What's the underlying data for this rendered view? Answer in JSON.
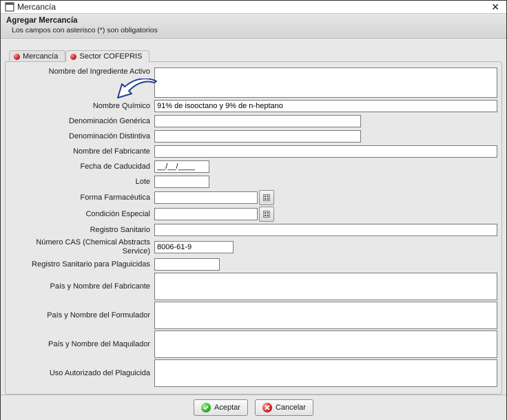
{
  "window": {
    "title": "Mercancía"
  },
  "header": {
    "title": "Agregar Mercancía",
    "subtitle": "Los campos con asterisco (*) son obligatorios"
  },
  "tabs": {
    "mercancia": "Mercancía",
    "cofepris": "Sector COFEPRIS"
  },
  "labels": {
    "nombre_ingrediente": "Nombre del Ingrediente Activo",
    "nombre_quimico": "Nombre Químico",
    "denominacion_generica": "Denominación Genérica",
    "denominacion_distintiva": "Denominación Distintiva",
    "nombre_fabricante": "Nombre del Fabricante",
    "fecha_caducidad": "Fecha de Caducidad",
    "lote": "Lote",
    "forma_farmaceutica": "Forma Farmacéutica",
    "condicion_especial": "Condición Especial",
    "registro_sanitario": "Registro Sanitario",
    "cas": "Número CAS (Chemical Abstracts Service)",
    "reg_san_plag": "Registro Sanitario para Plaguicidas",
    "pais_fab": "País y Nombre del Fabricante",
    "pais_form": "País y Nombre del Formulador",
    "pais_maq": "País y Nombre del Maquilador",
    "uso_aut": "Uso Autorizado del Plaguicida"
  },
  "values": {
    "nombre_ingrediente": "",
    "nombre_quimico": "91% de isooctano y 9% de n-heptano",
    "denominacion_generica": "",
    "denominacion_distintiva": "",
    "nombre_fabricante": "",
    "fecha_caducidad": "__/__/____",
    "lote": "",
    "forma_farmaceutica": "",
    "condicion_especial": "",
    "registro_sanitario": "",
    "cas": "8006-61-9",
    "reg_san_plag": "",
    "pais_fab": "",
    "pais_form": "",
    "pais_maq": "",
    "uso_aut": ""
  },
  "buttons": {
    "aceptar": "Aceptar",
    "cancelar": "Cancelar"
  }
}
